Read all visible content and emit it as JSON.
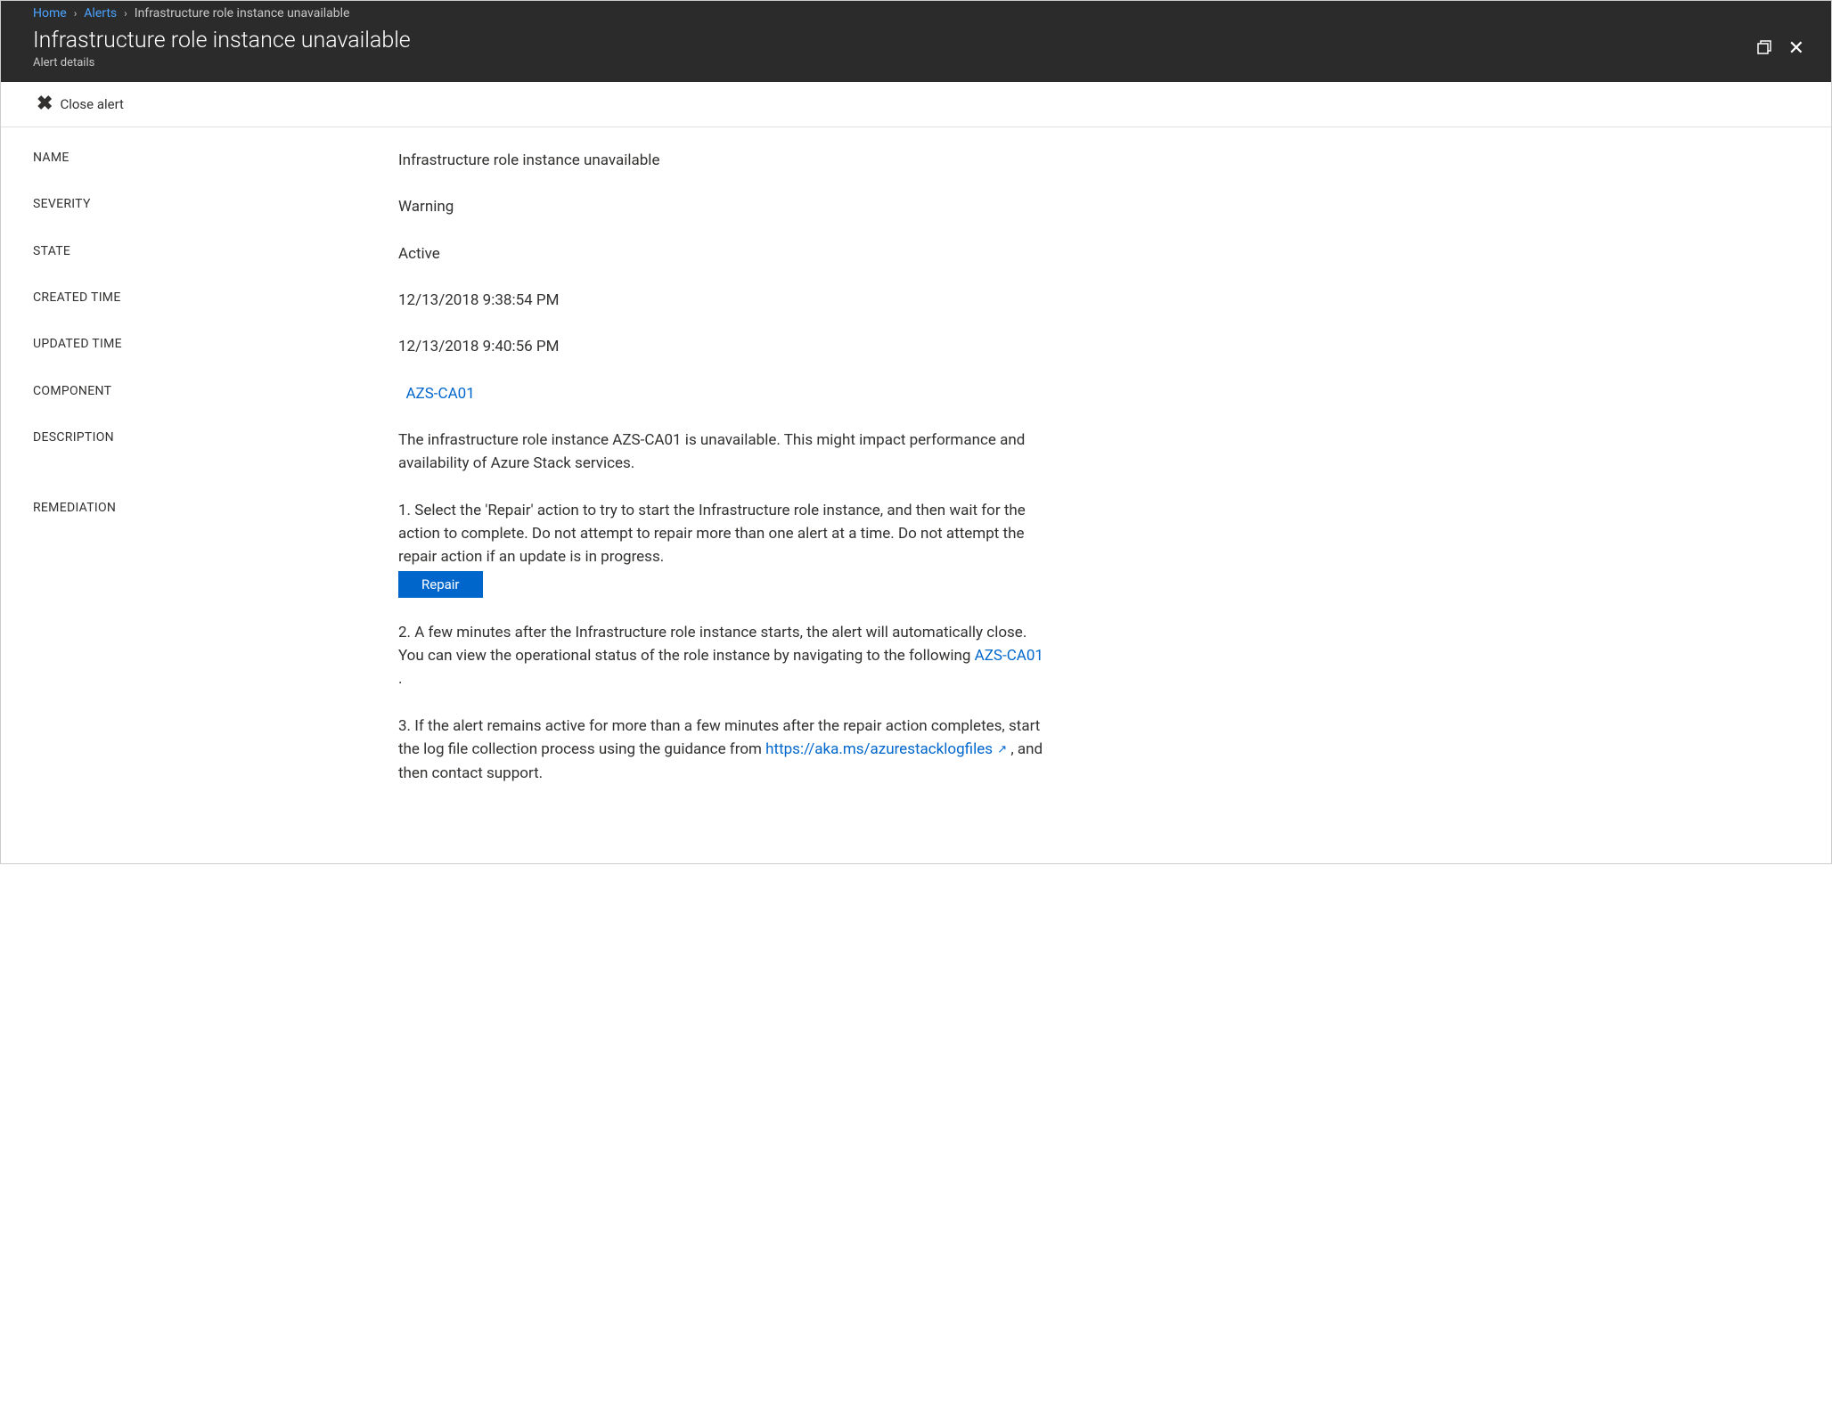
{
  "breadcrumb": {
    "home": "Home",
    "alerts": "Alerts",
    "current": "Infrastructure role instance unavailable"
  },
  "header": {
    "title": "Infrastructure role instance unavailable",
    "subtitle": "Alert details"
  },
  "toolbar": {
    "close_alert_label": "Close alert"
  },
  "labels": {
    "name": "NAME",
    "severity": "SEVERITY",
    "state": "STATE",
    "created_time": "CREATED TIME",
    "updated_time": "UPDATED TIME",
    "component": "COMPONENT",
    "description": "DESCRIPTION",
    "remediation": "REMEDIATION"
  },
  "values": {
    "name": "Infrastructure role instance unavailable",
    "severity": "Warning",
    "state": "Active",
    "created_time": "12/13/2018 9:38:54 PM",
    "updated_time": "12/13/2018 9:40:56 PM",
    "component": "AZS-CA01",
    "description": "The infrastructure role instance AZS-CA01 is unavailable. This might impact performance and availability of Azure Stack services."
  },
  "remediation": {
    "step1": "1. Select the 'Repair' action to try to start the Infrastructure role instance, and then wait for the action to complete. Do not attempt to repair more than one alert at a time. Do not attempt the repair action if an update is in progress.",
    "repair_button": "Repair",
    "step2_pre": "2. A few minutes after the Infrastructure role instance starts, the alert will automatically close. You can view the operational status of the role instance by navigating to the following ",
    "step2_link": "AZS-CA01",
    "step2_post": " .",
    "step3_pre": "3. If the alert remains active for more than a few minutes after the repair action completes, start the log file collection process using the guidance from ",
    "step3_link": "https://aka.ms/azurestacklogfiles",
    "step3_post": " , and then contact support."
  }
}
